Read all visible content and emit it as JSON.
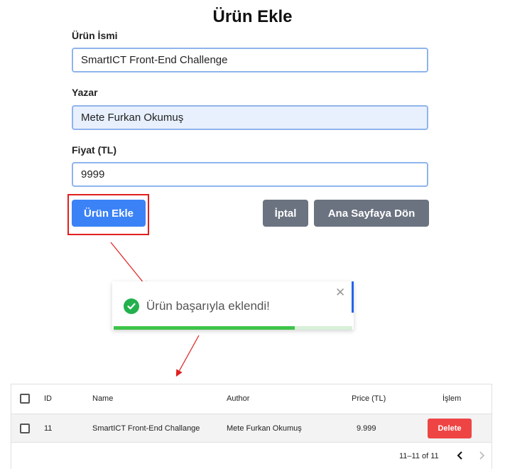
{
  "page": {
    "title": "Ürün Ekle"
  },
  "form": {
    "name_label": "Ürün İsmi",
    "name_value": "SmartICT Front-End Challenge",
    "author_label": "Yazar",
    "author_value": "Mete Furkan Okumuş",
    "price_label": "Fiyat (TL)",
    "price_value": "9999",
    "submit_label": "Ürün Ekle",
    "cancel_label": "İptal",
    "home_label": "Ana Sayfaya Dön"
  },
  "toast": {
    "message": "Ürün başarıyla eklendi!",
    "close_symbol": "✕",
    "progress": 0.76,
    "icon": "check-circle-icon",
    "color_success": "#22b14c"
  },
  "table": {
    "columns": [
      "ID",
      "Name",
      "Author",
      "Price (TL)",
      "İşlem"
    ],
    "rows": [
      {
        "id": "11",
        "name": "SmartICT Front-End Challange",
        "author": "Mete Furkan Okumuş",
        "price": "9.999",
        "action": "Delete"
      }
    ],
    "pagination": "11–11 of 11"
  },
  "colors": {
    "primary": "#3b82f6",
    "secondary": "#6b7280",
    "danger": "#ef4444",
    "annotation": "#e01f1f"
  }
}
